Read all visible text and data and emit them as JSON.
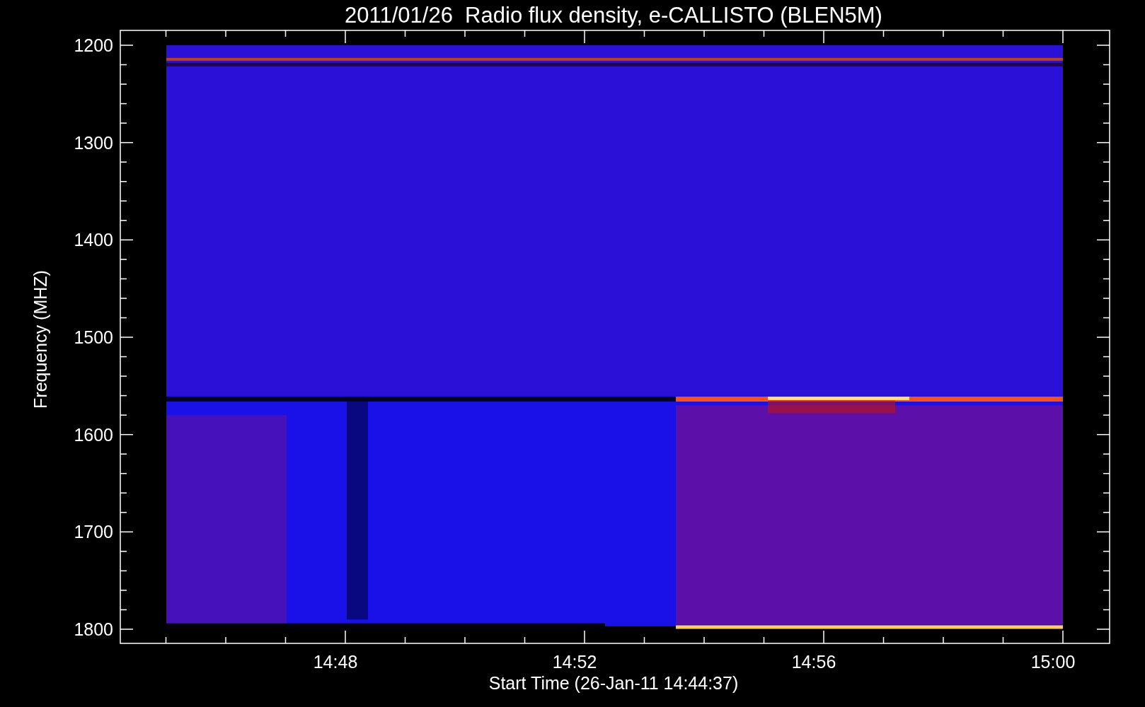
{
  "plot": {
    "title": "2011/01/26  Radio flux density, e-CALLISTO (BLEN5M)",
    "ylabel": "Frequency (MHZ)",
    "xlabel": "Start Time (26-Jan-11 14:44:37)",
    "y_tick_labels": [
      "1200",
      "1300",
      "1400",
      "1500",
      "1600",
      "1700",
      "1800"
    ],
    "x_tick_labels": [
      "14:48",
      "14:52",
      "14:56",
      "15:00"
    ]
  }
}
